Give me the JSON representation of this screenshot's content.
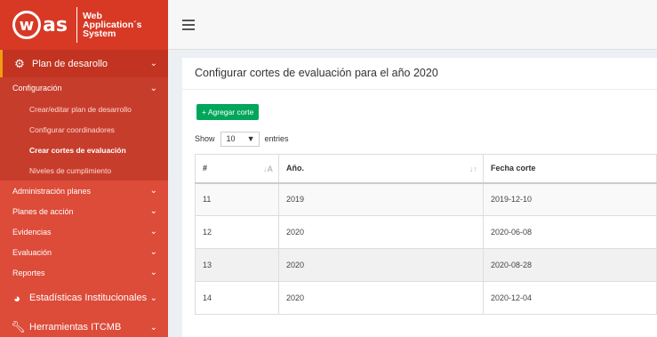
{
  "brand": {
    "logo_letter": "w",
    "logo_suffix": "as",
    "line1": "Web",
    "line2": "Application´s",
    "line3": "System"
  },
  "sidebar": {
    "plan_desarrollo": "Plan de desarollo",
    "configuracion": "Configuración",
    "config_items": [
      "Crear/editar plan de desarrollo",
      "Configurar coordinadores",
      "Crear cortes de evaluación",
      "Niveles de cumplimiento"
    ],
    "sub_items": [
      "Administración planes",
      "Planes de acción",
      "Evidencias",
      "Evaluación",
      "Reportes"
    ],
    "estadisticas": "Estadísticas Institucionales",
    "herramientas": "Herramientas ITCMB"
  },
  "main": {
    "title": "Configurar cortes de evaluación para el año 2020",
    "add_button": "+ Agregar corte",
    "show_label": "Show",
    "show_value": "10",
    "entries_label": "entries",
    "table": {
      "headers": [
        "#",
        "Año.",
        "Fecha corte"
      ],
      "rows": [
        [
          "11",
          "2019",
          "2019-12-10"
        ],
        [
          "12",
          "2020",
          "2020-06-08"
        ],
        [
          "13",
          "2020",
          "2020-08-28"
        ],
        [
          "14",
          "2020",
          "2020-12-04"
        ]
      ]
    }
  },
  "colors": {
    "sidebar": "#dd4b39",
    "accent": "#f39c12",
    "button": "#00a65a"
  }
}
